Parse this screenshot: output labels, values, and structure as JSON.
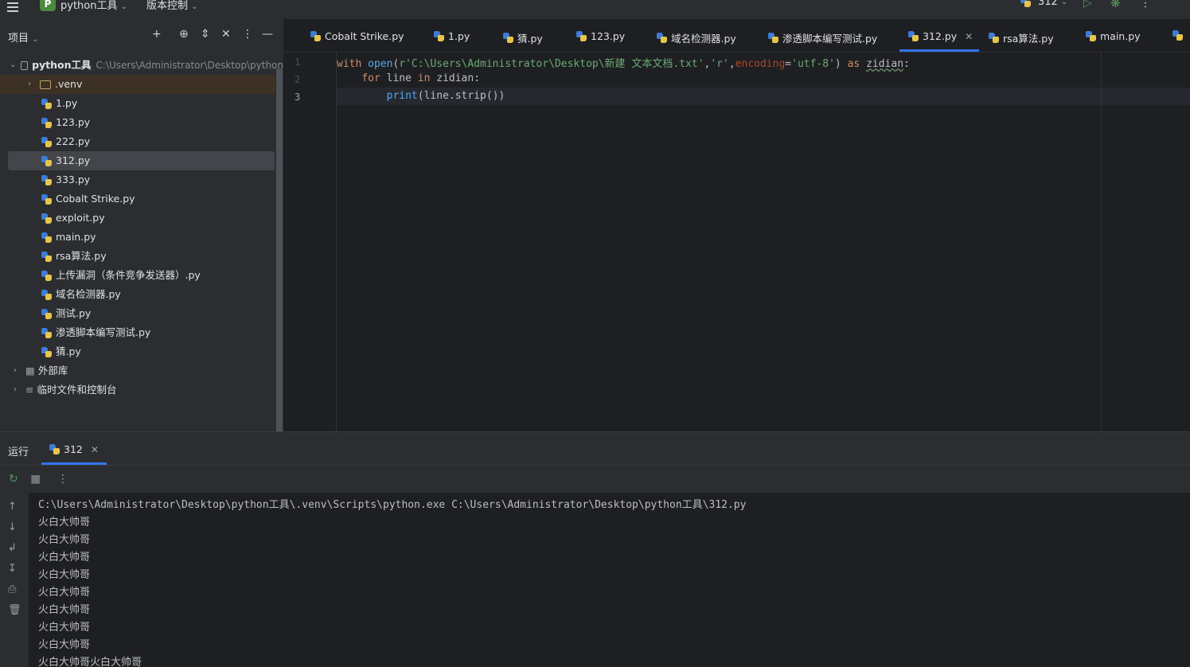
{
  "titlebar": {
    "project_badge": "P",
    "project_name": "python工具",
    "vcs_label": "版本控制",
    "run_config": "312"
  },
  "sidebar": {
    "title": "项目",
    "root_name": "python工具",
    "root_path": "C:\\Users\\Administrator\\Desktop\\python",
    "items": [
      {
        "label": ".venv"
      },
      {
        "label": "1.py"
      },
      {
        "label": "123.py"
      },
      {
        "label": "222.py"
      },
      {
        "label": "312.py"
      },
      {
        "label": "333.py"
      },
      {
        "label": "Cobalt Strike.py"
      },
      {
        "label": "exploit.py"
      },
      {
        "label": "main.py"
      },
      {
        "label": "rsa算法.py"
      },
      {
        "label": "上传漏洞（条件竞争发送器）.py"
      },
      {
        "label": "域名检测器.py"
      },
      {
        "label": "测试.py"
      },
      {
        "label": "渗透脚本编写测试.py"
      },
      {
        "label": "猜.py"
      }
    ],
    "external_libs": "外部库",
    "scratches": "临时文件和控制台"
  },
  "tabs": [
    {
      "label": "Cobalt Strike.py"
    },
    {
      "label": "1.py"
    },
    {
      "label": "猜.py"
    },
    {
      "label": "123.py"
    },
    {
      "label": "域名检测器.py"
    },
    {
      "label": "渗透脚本编写测试.py"
    },
    {
      "label": "312.py"
    },
    {
      "label": "rsa算法.py"
    },
    {
      "label": "main.py"
    }
  ],
  "editor": {
    "line_numbers": [
      "1",
      "2",
      "3"
    ],
    "line1": {
      "kw_with": "with",
      "fn_open": "open",
      "p1": "(",
      "str_path": "r'C:\\Users\\Administrator\\Desktop\\新建 文本文档.txt'",
      "comma1": ",",
      "str_mode": "'r'",
      "comma2": ",",
      "param_encoding": "encoding",
      "eq": "=",
      "str_enc": "'utf-8'",
      "p2": ") ",
      "kw_as": "as",
      "sp": " ",
      "var_zidian": "zidian",
      "colon": ":"
    },
    "line2": {
      "indent": "    ",
      "kw_for": "for",
      "t1": " line ",
      "kw_in": "in",
      "t2": " zidian:"
    },
    "line3": {
      "indent": "        ",
      "fn_print": "print",
      "t1": "(line.strip())"
    }
  },
  "run_panel": {
    "title": "运行",
    "tab_label": "312",
    "output": [
      "C:\\Users\\Administrator\\Desktop\\python工具\\.venv\\Scripts\\python.exe C:\\Users\\Administrator\\Desktop\\python工具\\312.py",
      "火白大帅哥",
      "火白大帅哥",
      "火白大帅哥",
      "火白大帅哥",
      "火白大帅哥",
      "火白大帅哥",
      "火白大帅哥",
      "火白大帅哥",
      "火白大帅哥火白大帅哥"
    ]
  }
}
